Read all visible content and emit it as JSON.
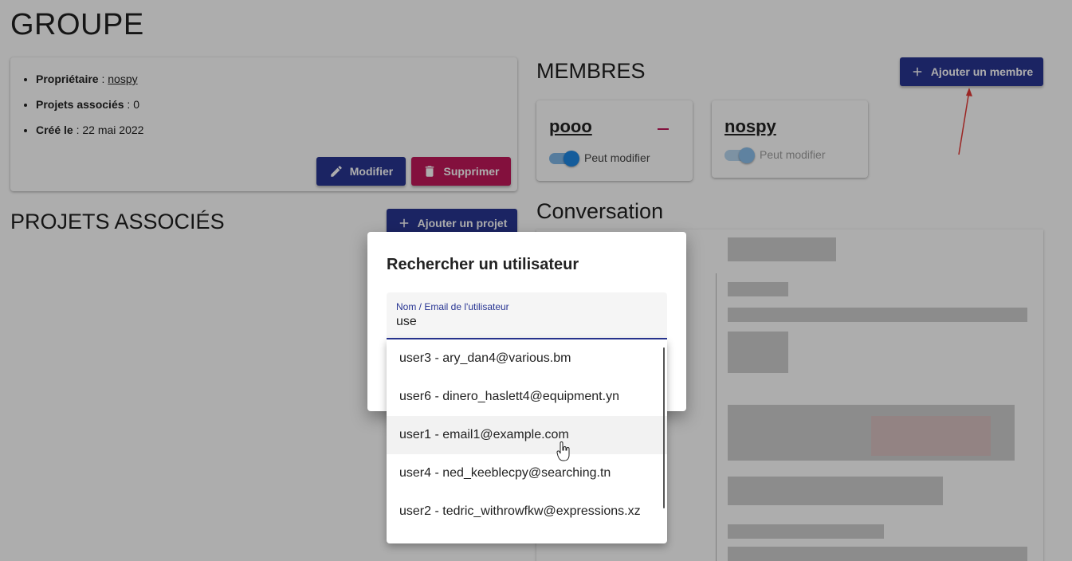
{
  "page": {
    "title": "GROUPE"
  },
  "info": {
    "owner_label": "Propriétaire",
    "owner_value": "nospy",
    "projects_label": "Projets associés",
    "projects_value": "0",
    "created_label": "Créé le",
    "created_value": "22 mai 2022",
    "modify_label": "Modifier",
    "delete_label": "Supprimer"
  },
  "projects": {
    "title": "PROJETS ASSOCIÉS",
    "add_label": "Ajouter un projet"
  },
  "members": {
    "title": "MEMBRES",
    "add_label": "Ajouter un membre",
    "list": [
      {
        "name": "pooo",
        "permission_label": "Peut modifier",
        "can_edit": true
      },
      {
        "name": "nospy",
        "permission_label": "Peut modifier",
        "can_edit": true
      }
    ]
  },
  "conversation": {
    "title": "Conversation"
  },
  "dialog": {
    "title": "Rechercher un utilisateur",
    "field_label": "Nom / Email de l'utilisateur",
    "field_value": "use",
    "results": [
      "user3 - ary_dan4@various.bm",
      "user6 - dinero_haslett4@equipment.yn",
      "user1 - email1@example.com",
      "user4 - ned_keeblecpy@searching.tn",
      "user2 - tedric_withrowfkw@expressions.xz"
    ]
  },
  "colors": {
    "primary": "#283593",
    "danger": "#c2185b",
    "toggle": "#1e88e5"
  },
  "icons": {
    "modify": "pencil-icon",
    "delete": "trash-icon",
    "add": "plus-icon"
  }
}
